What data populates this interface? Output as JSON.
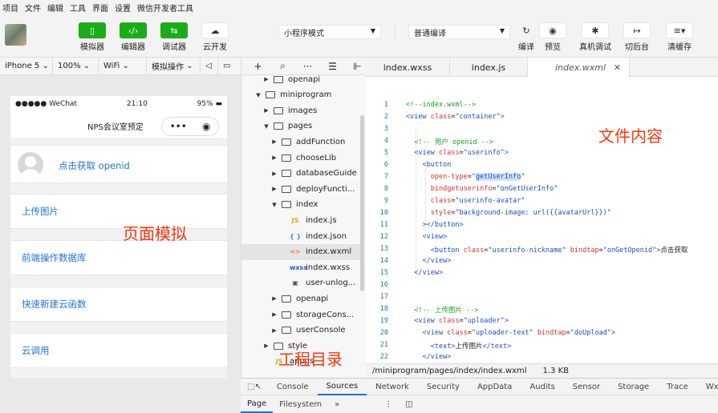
{
  "menu": [
    "项目",
    "文件",
    "编辑",
    "工具",
    "界面",
    "设置",
    "微信开发者工具"
  ],
  "toolbar": {
    "simulator": "模拟器",
    "editor": "编辑器",
    "debugger": "调试器",
    "cloud": "云开发",
    "mode_select": "小程序模式",
    "compile_select": "普通编译",
    "compile": "编译",
    "preview": "预览",
    "remote_debug": "真机调试",
    "background": "切后台",
    "clear_cache": "清缓存"
  },
  "sim_bar": {
    "device": "iPhone 5",
    "zoom": "100%",
    "network": "WiFi",
    "operate": "模拟操作"
  },
  "phone": {
    "carrier": "●●●●● WeChat",
    "time": "21:10",
    "battery": "95%",
    "title": "NPS会议室预定",
    "openid_link": "点击获取 openid",
    "items": [
      "上传图片",
      "前端操作数据库",
      "快速新建云函数",
      "云调用"
    ]
  },
  "annotations": {
    "page": "页面模拟",
    "file": "文件内容",
    "tree": "工程目录"
  },
  "tree": [
    {
      "label": "openapi",
      "type": "folder",
      "depth": 1,
      "open": false
    },
    {
      "label": "miniprogram",
      "type": "folder",
      "depth": 0,
      "open": true
    },
    {
      "label": "images",
      "type": "folder",
      "depth": 1,
      "open": false
    },
    {
      "label": "pages",
      "type": "folder",
      "depth": 1,
      "open": true
    },
    {
      "label": "addFunction",
      "type": "folder",
      "depth": 2,
      "open": false
    },
    {
      "label": "chooseLib",
      "type": "folder",
      "depth": 2,
      "open": false
    },
    {
      "label": "databaseGuide",
      "type": "folder",
      "depth": 2,
      "open": false
    },
    {
      "label": "deployFuncti...",
      "type": "folder",
      "depth": 2,
      "open": false
    },
    {
      "label": "index",
      "type": "folder",
      "depth": 2,
      "open": true
    },
    {
      "label": "index.js",
      "type": "js",
      "depth": 3
    },
    {
      "label": "index.json",
      "type": "json",
      "depth": 3
    },
    {
      "label": "index.wxml",
      "type": "wxml",
      "depth": 3,
      "selected": true
    },
    {
      "label": "index.wxss",
      "type": "wxss",
      "depth": 3
    },
    {
      "label": "user-unlog...",
      "type": "img",
      "depth": 3
    },
    {
      "label": "openapi",
      "type": "folder",
      "depth": 2,
      "open": false
    },
    {
      "label": "storageCons...",
      "type": "folder",
      "depth": 2,
      "open": false
    },
    {
      "label": "userConsole",
      "type": "folder",
      "depth": 2,
      "open": false
    },
    {
      "label": "style",
      "type": "folder",
      "depth": 1,
      "open": false
    },
    {
      "label": "app.js",
      "type": "js",
      "depth": 1
    }
  ],
  "tabs": [
    "index.wxss",
    "index.js",
    "index.wxml"
  ],
  "code_lines": [
    "1",
    "2",
    "3",
    "4",
    "5",
    "6",
    "7",
    "8",
    "9",
    "10",
    "11",
    "12",
    "13",
    "14",
    "15",
    "16",
    "17",
    "18",
    "19",
    "20",
    "21",
    "22"
  ],
  "status_file": {
    "path": "/miniprogram/pages/index/index.wxml",
    "size": "1.3 KB"
  },
  "devtools_tabs": [
    "Console",
    "Sources",
    "Network",
    "Security",
    "AppData",
    "Audits",
    "Sensor",
    "Storage",
    "Trace",
    "Wxml"
  ],
  "devtools_active": "Sources",
  "sub_tabs": [
    "Page",
    "Filesystem"
  ]
}
